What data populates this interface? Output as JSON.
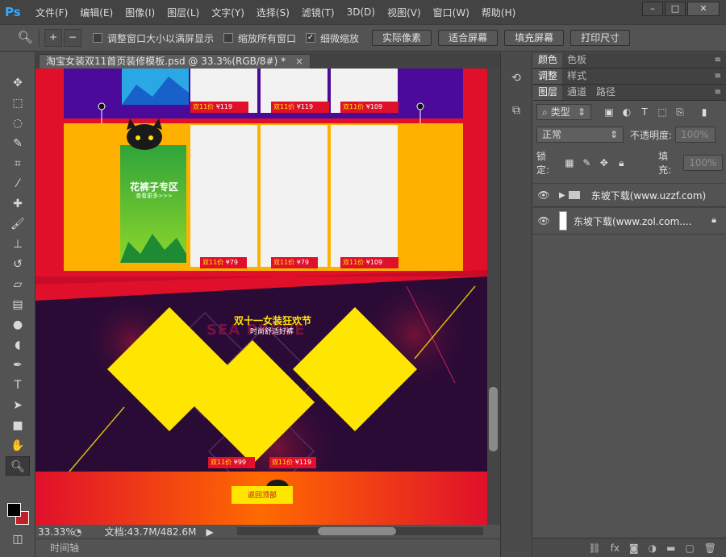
{
  "app": {
    "logo": "Ps",
    "menu": [
      "文件(F)",
      "编辑(E)",
      "图像(I)",
      "图层(L)",
      "文字(Y)",
      "选择(S)",
      "滤镜(T)",
      "3D(D)",
      "视图(V)",
      "窗口(W)",
      "帮助(H)"
    ],
    "window_buttons": [
      "–",
      "□",
      "✕"
    ]
  },
  "options": {
    "tool_icon": "zoom-icon",
    "checks": [
      {
        "label": "调整窗口大小以满屏显示",
        "checked": false
      },
      {
        "label": "缩放所有窗口",
        "checked": false
      },
      {
        "label": "细微缩放",
        "checked": true
      }
    ],
    "buttons": [
      "实际像素",
      "适合屏幕",
      "填充屏幕",
      "打印尺寸"
    ]
  },
  "document": {
    "tab_title": "淘宝女装双11首页装修模板.psd @ 33.3%(RGB/8#) *",
    "tab_close": "×",
    "zoom": "33.33%",
    "doc_info": "文档:43.7M/482.6M",
    "timeline_label": "时间轴"
  },
  "canvas": {
    "price_tag_label": "双11价",
    "prices_row1": [
      "¥119",
      "¥119",
      "¥109"
    ],
    "prices_row2": [
      "¥79",
      "¥79",
      "¥109"
    ],
    "promo_title": "花裤子专区",
    "promo_sub": "查看更多>>>",
    "event_title": "双十一女装狂欢节",
    "event_sub": "时尚舒适好裤",
    "event_bg_text": "SEA PROVE",
    "diamond_prices": [
      "¥99",
      "¥119"
    ],
    "back_to_top": "返回顶部"
  },
  "panels": {
    "row1_tabs": [
      "颜色",
      "色板"
    ],
    "row2_tabs": [
      "调整",
      "样式"
    ],
    "row3_tabs": [
      "图层",
      "通道",
      "路径"
    ],
    "filter_type": "类型",
    "blend_mode": "正常",
    "opacity_label": "不透明度:",
    "opacity_value": "100%",
    "lock_label": "锁定:",
    "fill_label": "填充:",
    "fill_value": "100%",
    "layers": [
      {
        "name": "东坡下载(www.uzzf.com)",
        "type": "group"
      },
      {
        "name": "东坡下载(www.zol.com....",
        "type": "layer",
        "locked": true
      }
    ]
  },
  "colors": {
    "accent_red": "#e0102b",
    "accent_yellow": "#ffe600",
    "orange_bg": "#ffb100",
    "dark_purple": "#2a0b36"
  }
}
